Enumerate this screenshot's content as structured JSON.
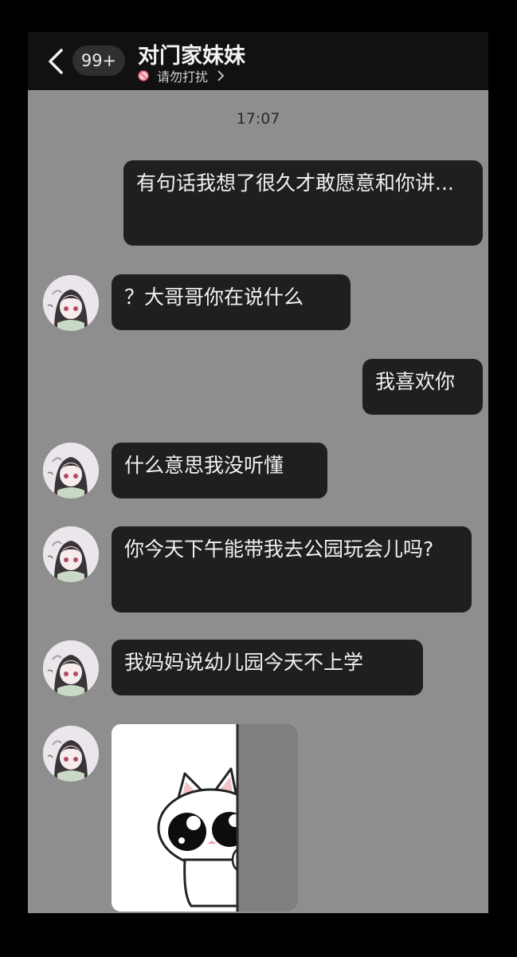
{
  "header": {
    "unread_badge": "99+",
    "contact_name": "对门家妹妹",
    "dnd_label": "请勿打扰"
  },
  "chat": {
    "timestamp": "17:07",
    "messages": [
      {
        "sender": "me",
        "text": "有句话我想了很久才敢愿意和你讲..."
      },
      {
        "sender": "contact",
        "text": "？大哥哥你在说什么"
      },
      {
        "sender": "me",
        "text": "我喜欢你"
      },
      {
        "sender": "contact",
        "text": "什么意思我没听懂"
      },
      {
        "sender": "contact",
        "text": "你今天下午能带我去公园玩会儿吗?"
      },
      {
        "sender": "contact",
        "text": "我妈妈说幼儿园今天不上学"
      },
      {
        "sender": "contact",
        "type": "sticker",
        "sticker": "peeking-cat-sticker"
      }
    ]
  },
  "colors": {
    "chat_background": "#8e8e8e",
    "bubble": "#1f1f1f",
    "bubble_text": "#f1f1f1",
    "header": "#111111"
  }
}
